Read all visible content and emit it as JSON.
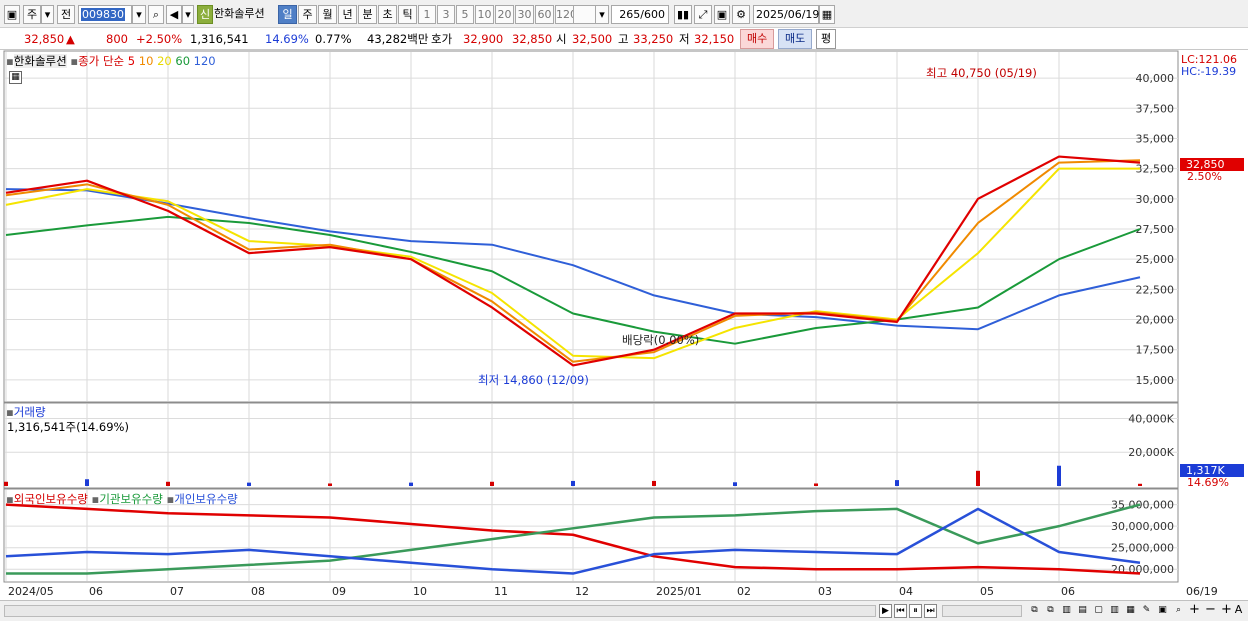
{
  "toolbar": {
    "market": "주",
    "prev": "전",
    "code": "009830",
    "sin": "신",
    "name": "한화솔루션",
    "periods": [
      "일",
      "주",
      "월",
      "년",
      "분",
      "초",
      "틱"
    ],
    "minutes": [
      "1",
      "3",
      "5",
      "10",
      "20",
      "30",
      "60",
      "120"
    ],
    "count": "265",
    "count_total": "/600",
    "date": "2025/06/19"
  },
  "quote": {
    "price": "32,850",
    "arrow": "▲",
    "change": "800",
    "change_pct": "+2.50%",
    "volume": "1,316,541",
    "turnover_ratio": "14.69%",
    "ratio2": "0.77%",
    "amount": "43,282백만",
    "ask_label": "호가",
    "ask": "32,900",
    "bid": "32,850",
    "open_label": "시",
    "open": "32,500",
    "high_label": "고",
    "high": "33,250",
    "low_label": "저",
    "low": "32,150",
    "buy": "매수",
    "sell": "매도",
    "eval": "평"
  },
  "price_panel": {
    "legend_name": "한화솔루션",
    "legend_ma_label": "종가 단순",
    "ma_periods": [
      "5",
      "10",
      "20",
      "60",
      "120"
    ],
    "lc": "LC:121.06",
    "hc": "HC:-19.39",
    "current_tag": "32,850",
    "current_pct": "2.50%",
    "high_note": "최고 40,750 (05/19)",
    "low_note": "최저 14,860 (12/09)",
    "dividend_note": "배당락(0.00%)",
    "y_ticks": [
      "40,000",
      "37,500",
      "35,000",
      "32,500",
      "30,000",
      "27,500",
      "25,000",
      "22,500",
      "20,000",
      "17,500",
      "15,000"
    ]
  },
  "volume_panel": {
    "title": "거래량",
    "value": "1,316,541주(14.69%)",
    "y_ticks": [
      "40,000K",
      "20,000K"
    ],
    "tag": "1,317K",
    "tag_pct": "14.69%"
  },
  "holding_panel": {
    "legend": [
      "외국인보유수량",
      "기관보유수량",
      "개인보유수량"
    ],
    "y_ticks": [
      "35,000,000",
      "30,000,000",
      "25,000,000",
      "20,000,000"
    ]
  },
  "x_axis": [
    "2024/05",
    "06",
    "07",
    "08",
    "09",
    "10",
    "11",
    "12",
    "2025/01",
    "02",
    "03",
    "04",
    "05",
    "06",
    "06/19"
  ],
  "colors": {
    "up": "#d40000",
    "down": "#1c3cd6",
    "ma5": "#e00000",
    "ma10": "#f08a00",
    "ma20": "#f5e400",
    "ma60": "#1a9a3a",
    "ma120": "#2f5fd8",
    "foreign": "#e00000",
    "institution": "#3a9a5a",
    "individual": "#2850d8"
  },
  "chart_data": [
    {
      "type": "line",
      "title": "",
      "x": [
        "2024/05",
        "06",
        "07",
        "08",
        "09",
        "10",
        "11",
        "12",
        "2025/01",
        "02",
        "03",
        "04",
        "05",
        "06",
        "06/19"
      ],
      "series": [
        {
          "name": "5",
          "values": [
            30500,
            31500,
            29000,
            25500,
            26000,
            25000,
            21000,
            16200,
            17500,
            20500,
            20500,
            19800,
            30000,
            33500,
            33000
          ]
        },
        {
          "name": "10",
          "values": [
            30300,
            31200,
            29500,
            25800,
            26200,
            25000,
            21500,
            16500,
            17300,
            20300,
            20600,
            19900,
            28000,
            33000,
            33200
          ]
        },
        {
          "name": "20",
          "values": [
            29500,
            30800,
            29800,
            26500,
            26100,
            25200,
            22200,
            17000,
            16800,
            19300,
            20700,
            20000,
            25500,
            32500,
            32500
          ]
        },
        {
          "name": "60",
          "values": [
            27000,
            27800,
            28500,
            28000,
            27000,
            25600,
            24000,
            20500,
            19000,
            18000,
            19300,
            20000,
            21000,
            25000,
            27500
          ]
        },
        {
          "name": "120",
          "values": [
            30800,
            30700,
            29600,
            28400,
            27300,
            26500,
            26200,
            24500,
            22000,
            20500,
            20200,
            19500,
            19200,
            22000,
            23500
          ]
        }
      ],
      "ylim": [
        13500,
        41500
      ]
    },
    {
      "type": "bar",
      "title": "",
      "ylabel": "",
      "categories": [
        "2024/05",
        "06",
        "07",
        "08",
        "09",
        "10",
        "11",
        "12",
        "2025/01",
        "02",
        "03",
        "04",
        "05",
        "06",
        "06/19"
      ],
      "series": [
        {
          "name": "거래량",
          "values": [
            2500,
            4000,
            2500,
            2000,
            1500,
            2000,
            2500,
            3000,
            3000,
            2200,
            1500,
            3500,
            9000,
            12000,
            1317
          ]
        }
      ],
      "ylim": [
        0,
        45000
      ]
    },
    {
      "type": "line",
      "title": "",
      "x": [
        "2024/05",
        "06",
        "07",
        "08",
        "09",
        "10",
        "11",
        "12",
        "2025/01",
        "02",
        "03",
        "04",
        "05",
        "06",
        "06/19"
      ],
      "series": [
        {
          "name": "외국인보유수량",
          "values": [
            35000000,
            34000000,
            33000000,
            32500000,
            32000000,
            30500000,
            29000000,
            28000000,
            23000000,
            20500000,
            20000000,
            20000000,
            20500000,
            20000000,
            19000000
          ]
        },
        {
          "name": "기관보유수량",
          "values": [
            19000000,
            19000000,
            20000000,
            21000000,
            22000000,
            24500000,
            27000000,
            29500000,
            32000000,
            32500000,
            33500000,
            34000000,
            26000000,
            30000000,
            35000000
          ]
        },
        {
          "name": "개인보유수량",
          "values": [
            23000000,
            24000000,
            23500000,
            24500000,
            23000000,
            21500000,
            20000000,
            19000000,
            23500000,
            24500000,
            24000000,
            23500000,
            34000000,
            24000000,
            21500000
          ]
        }
      ],
      "ylim": [
        17500000,
        37000000
      ]
    }
  ]
}
